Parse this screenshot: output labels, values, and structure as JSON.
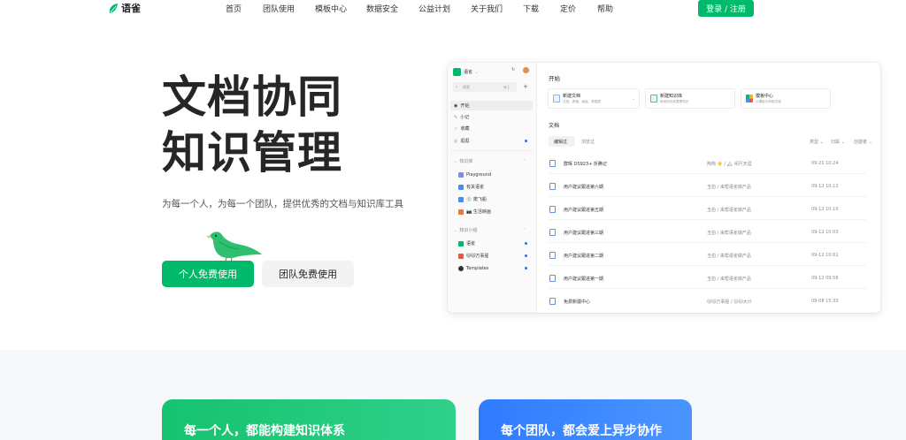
{
  "nav": {
    "logo_text": "语雀",
    "items": [
      "首页",
      "团队使用",
      "模板中心",
      "数据安全",
      "公益计划",
      "关于我们",
      "下载",
      "定价",
      "帮助"
    ],
    "login_label": "登录 / 注册"
  },
  "hero": {
    "title_line1": "文档协同",
    "title_line2": "知识管理",
    "subtitle": "为每一个人，为每一个团队，提供优秀的文档与知识库工具",
    "btn_personal": "个人免费使用",
    "btn_team": "团队免费使用"
  },
  "mock": {
    "sidebar": {
      "workspace": "语雀",
      "search_placeholder": "搜索",
      "search_shortcut": "⌘ J",
      "items": [
        "开始",
        "小记",
        "收藏",
        "逛逛"
      ],
      "kb_header": "知识库",
      "kb_items": [
        "Playground",
        "有关语雀",
        "💿 爬飞船",
        "📷 生活映画"
      ],
      "group_header": "知识小组",
      "group_items": [
        "语雀",
        "🐱🐱万事屋",
        "Templates"
      ]
    },
    "main": {
      "start_title": "开始",
      "cards": [
        {
          "title": "新建文档",
          "sub": "文档、表格、画板、数据表"
        },
        {
          "title": "新建知识库",
          "sub": "使用知识库整理知识"
        },
        {
          "title": "模板中心",
          "sub": "从模板中获取灵感"
        }
      ],
      "docs_title": "文档",
      "tabs": [
        "编辑过",
        "浏览过"
      ],
      "filters": [
        "类型",
        "归属",
        "创建者"
      ],
      "docs": [
        {
          "name": "群晖 DS923+ 折腾记",
          "author": "陶陶 ☀️ / 🏔 闲尺天涯",
          "time": "09-21 10:24"
        },
        {
          "name": "用户建议跟进第六期",
          "author": "玉伯 / 来帮语雀做产品",
          "time": "09-12 10:12"
        },
        {
          "name": "用户建议跟进第五期",
          "author": "玉伯 / 来帮语雀做产品",
          "time": "09-12 10:10"
        },
        {
          "name": "用户建议跟进第三期",
          "author": "玉伯 / 来帮语雀做产品",
          "time": "09-12 10:03"
        },
        {
          "name": "用户建议跟进第二期",
          "author": "玉伯 / 来帮语雀做产品",
          "time": "09-12 10:01"
        },
        {
          "name": "用户建议跟进第一期",
          "author": "玉伯 / 来帮语雀做产品",
          "time": "09-12 09:56"
        },
        {
          "name": "免费新疆中心",
          "author": "🐱🐱万事屋 / 🐱🐱大计",
          "time": "09-08 15:33"
        }
      ]
    }
  },
  "bottom": {
    "card1": "每一个人，都能构建知识体系",
    "card2": "每个团队，都会爱上异步协作"
  },
  "colors": {
    "brand": "#00b96b",
    "accent_blue": "#1677ff"
  }
}
